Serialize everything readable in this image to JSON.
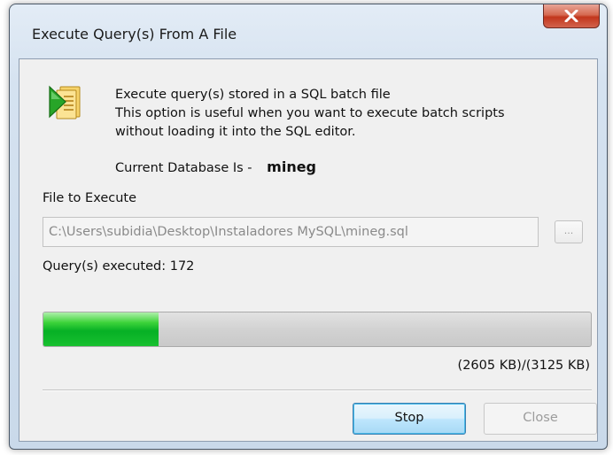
{
  "window": {
    "title": "Execute Query(s) From A File"
  },
  "description": {
    "line1": "Execute query(s) stored in a SQL batch file",
    "line2": "This option is useful when you want to execute batch scripts",
    "line3": "without loading it into the SQL editor."
  },
  "database": {
    "label": "Current Database Is -",
    "name": "mineg"
  },
  "file": {
    "label": "File to Execute",
    "path": "C:\\Users\\subidia\\Desktop\\Instaladores MySQL\\mineg.sql",
    "browse_label": "..."
  },
  "status": {
    "queries_executed": "Query(s) executed: 172"
  },
  "progress": {
    "fraction": 0.21,
    "size_text": "(2605 KB)/(3125 KB)"
  },
  "buttons": {
    "stop": "Stop",
    "close": "Close"
  },
  "icons": {
    "app": "run-script-icon",
    "close": "close-icon"
  },
  "colors": {
    "progress_green": "#06b025",
    "close_red": "#c2361d"
  }
}
